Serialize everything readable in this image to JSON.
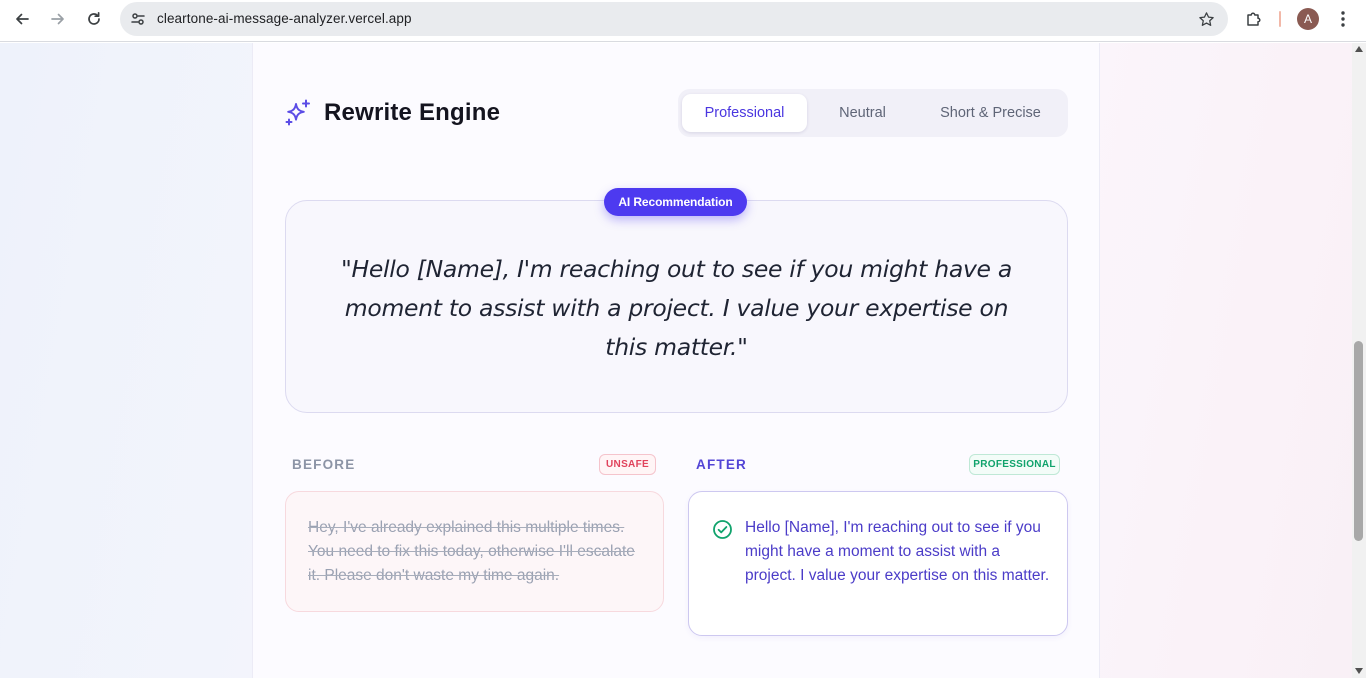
{
  "browser": {
    "url": "cleartone-ai-message-analyzer.vercel.app",
    "profile_initial": "A",
    "icons": {
      "back": "arrow-left-icon",
      "forward": "arrow-right-icon",
      "reload": "reload-icon",
      "site_info": "tune-icon",
      "bookmark": "star-icon",
      "extensions": "puzzle-icon",
      "menu": "kebab-menu-icon"
    }
  },
  "rewrite": {
    "title": "Rewrite Engine",
    "icon": "sparkle-icon",
    "tabs": [
      {
        "label": "Professional",
        "active": true
      },
      {
        "label": "Neutral",
        "active": false
      },
      {
        "label": "Short & Precise",
        "active": false
      }
    ]
  },
  "recommendation": {
    "badge": "AI Recommendation",
    "text": "\"Hello [Name], I'm reaching out to see if you might have a moment to assist with a project. I value your expertise on this matter.\""
  },
  "comparison": {
    "before": {
      "label": "BEFORE",
      "badge": "UNSAFE",
      "text": "Hey, I've already explained this multiple times. You need to fix this today, otherwise I'll escalate it. Please don't waste my time again."
    },
    "after": {
      "label": "AFTER",
      "badge": "PROFESSIONAL",
      "icon": "check-circle-icon",
      "text": "Hello [Name], I'm reaching out to see if you might have a moment to assist with a project. I value your expertise on this matter."
    }
  },
  "colors": {
    "accent": "#4d3af0",
    "unsafe": "#e0435c",
    "professional": "#10a36c"
  }
}
